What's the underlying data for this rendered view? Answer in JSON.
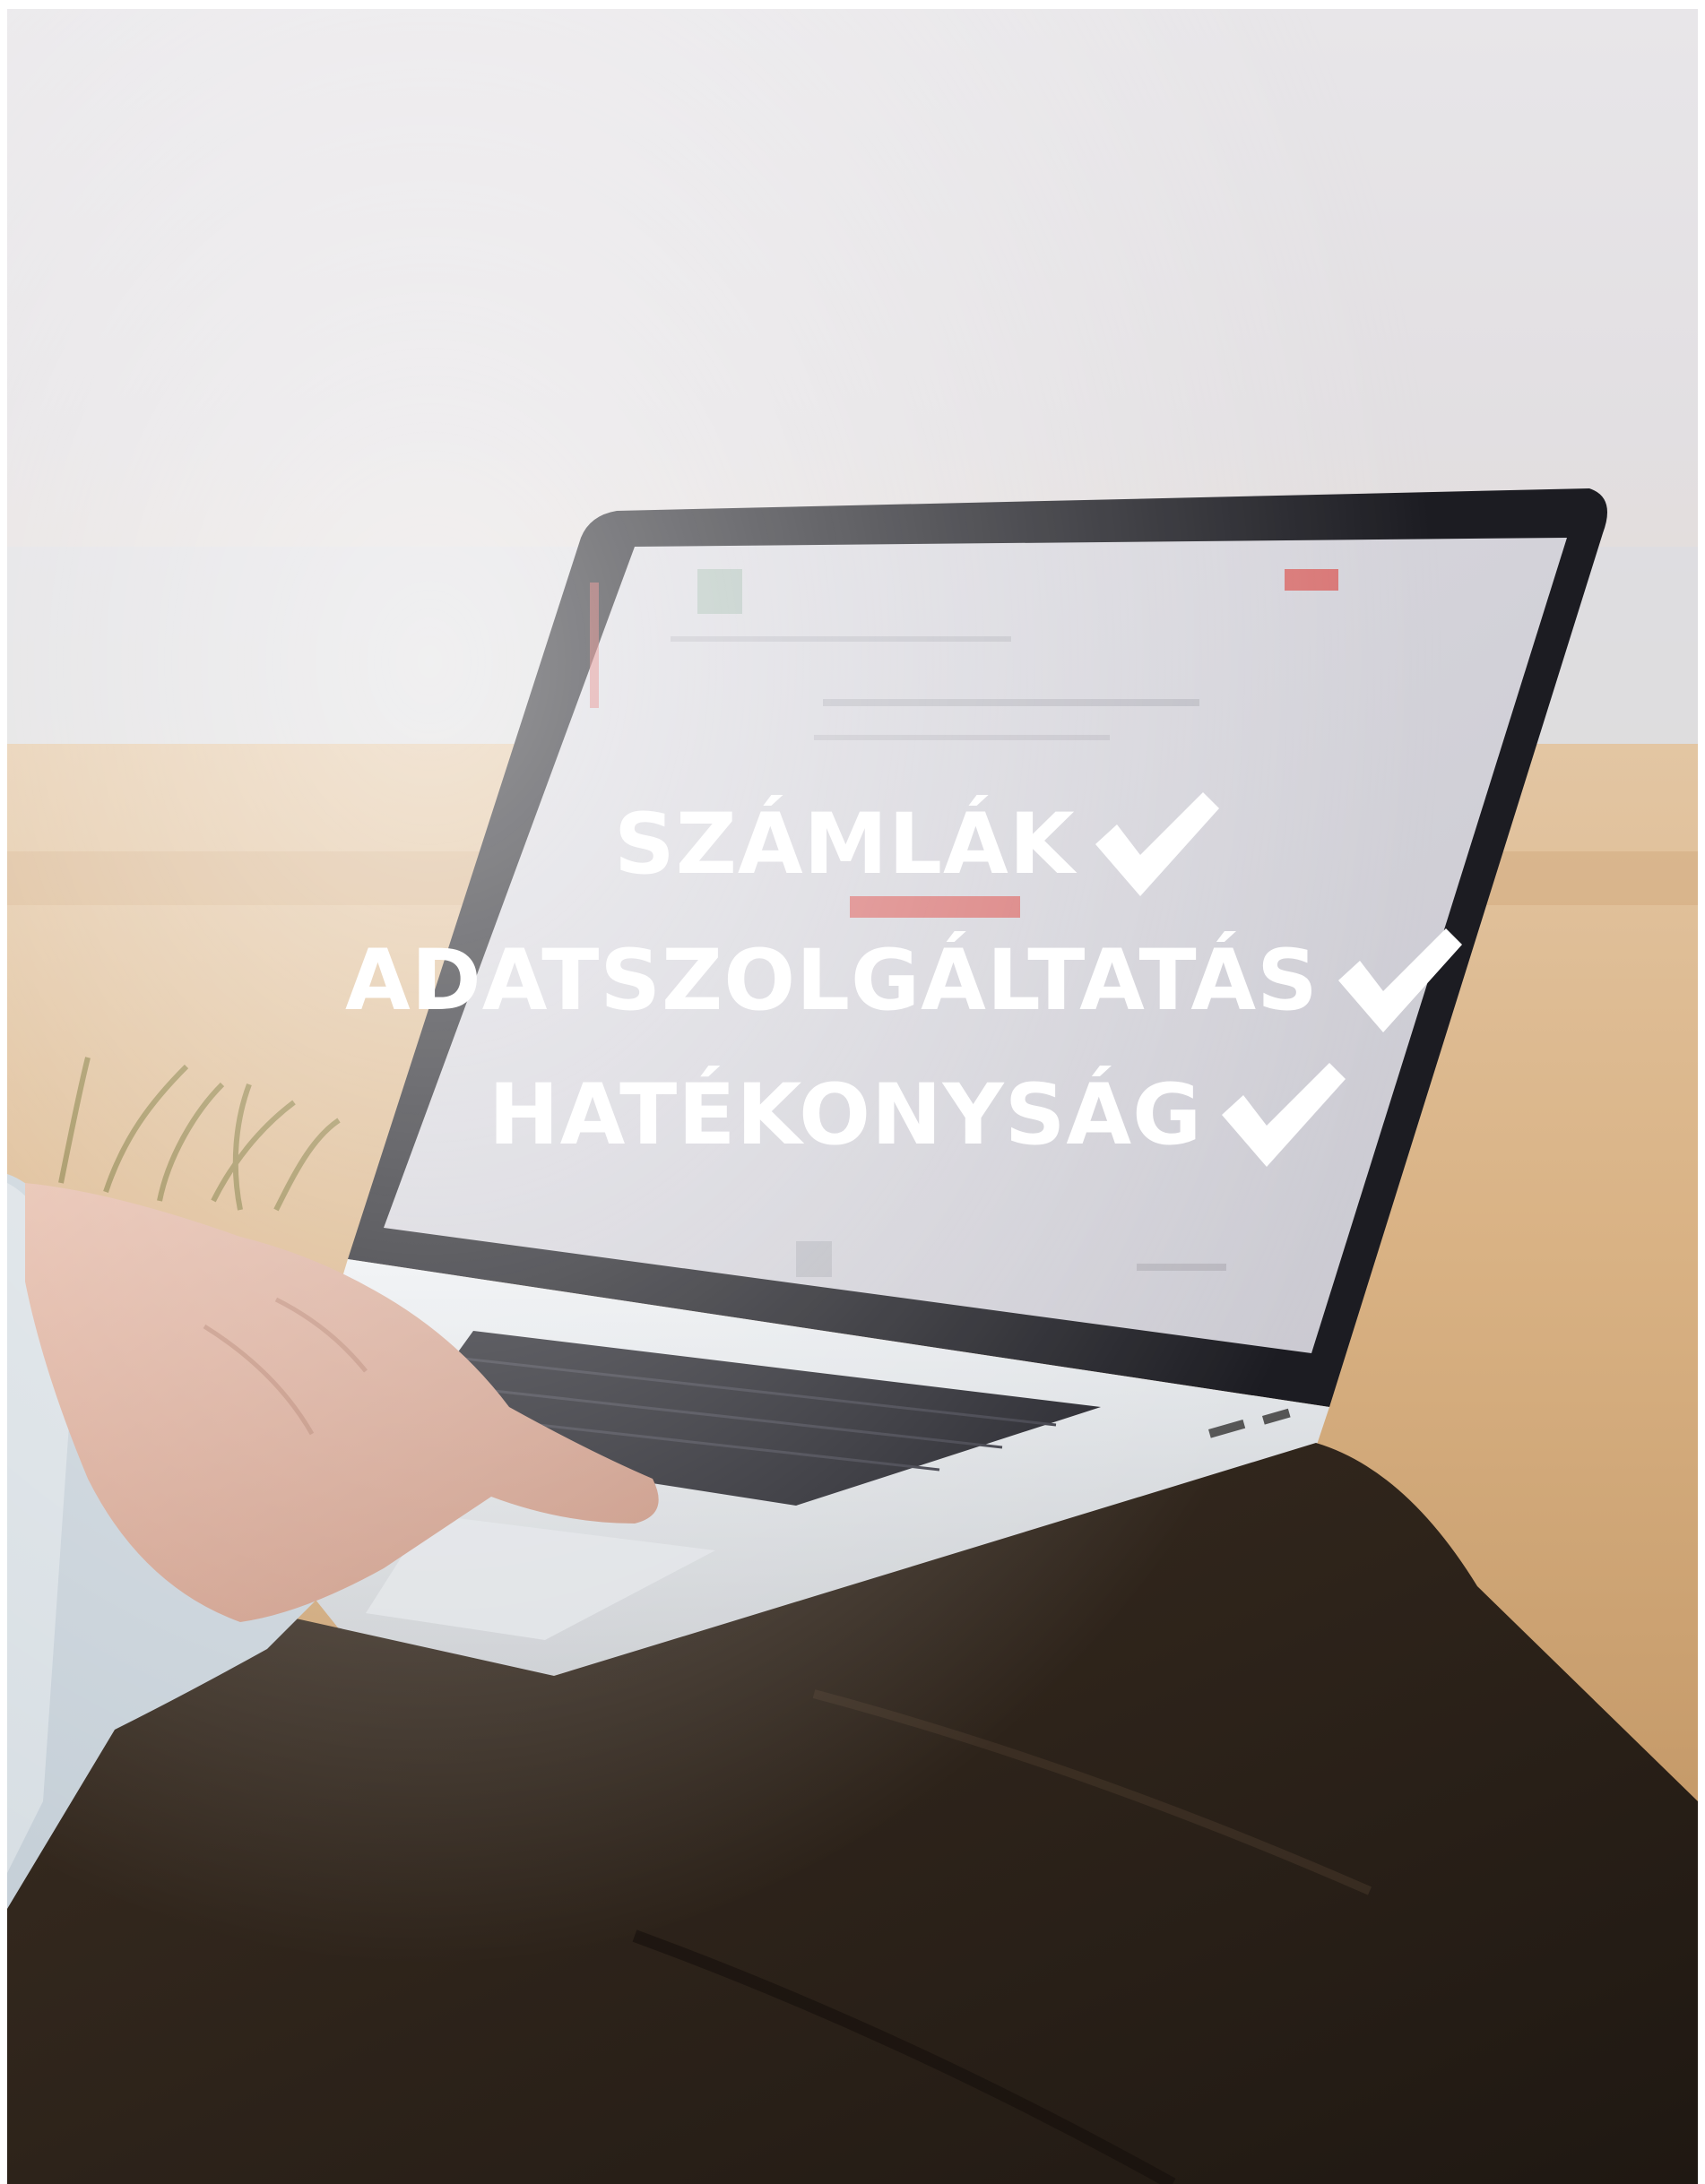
{
  "headline": {
    "lines": [
      {
        "text": "SZÁMLÁK",
        "checked": true
      },
      {
        "text": "ADATSZOLGÁLTATÁS",
        "checked": true
      },
      {
        "text": "HATÉKONYSÁG",
        "checked": true
      }
    ],
    "text_color": "#ffffff"
  },
  "icons": {
    "check": "checkmark-icon"
  },
  "colors": {
    "sky": "#e6e3e5",
    "sand": "#d2a874",
    "screen": "#d9d8de",
    "trousers": "#2e241b",
    "sleeve": "#c6d0d8",
    "accent_red": "#d9534f"
  }
}
